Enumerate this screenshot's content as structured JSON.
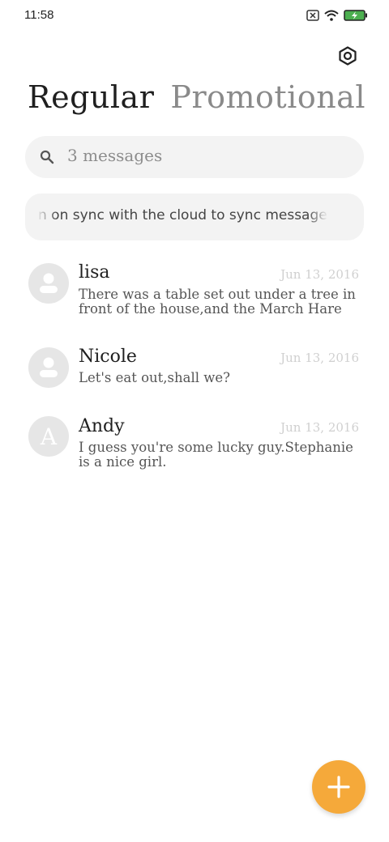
{
  "status_bar": {
    "time": "11:58",
    "icons": [
      "sim-off-icon",
      "wifi-icon",
      "battery-charging-icon"
    ],
    "battery_color": "#4caf50"
  },
  "header": {
    "settings_icon": "gear-icon"
  },
  "tabs": [
    {
      "label": "Regular",
      "active": true
    },
    {
      "label": "Promotional",
      "active": false
    }
  ],
  "search": {
    "text": "3 messages",
    "icon": "search-icon"
  },
  "sync_banner": {
    "text": "n on sync with the cloud to sync messages"
  },
  "conversations": [
    {
      "name": "lisa",
      "date": "Jun 13, 2016",
      "snippet": "There was a table set out under a tree in front of the house,and the March Hare an...",
      "avatar": "person-icon"
    },
    {
      "name": "Nicole",
      "date": "Jun 13, 2016",
      "snippet": "Let's eat out,shall we?",
      "avatar": "person-icon"
    },
    {
      "name": "Andy",
      "date": "Jun 13, 2016",
      "snippet": "I guess you're some lucky guy.Stephanie is a nice girl.",
      "avatar_letter": "A"
    }
  ],
  "fab": {
    "icon": "plus-icon",
    "color": "#f5a93a"
  }
}
